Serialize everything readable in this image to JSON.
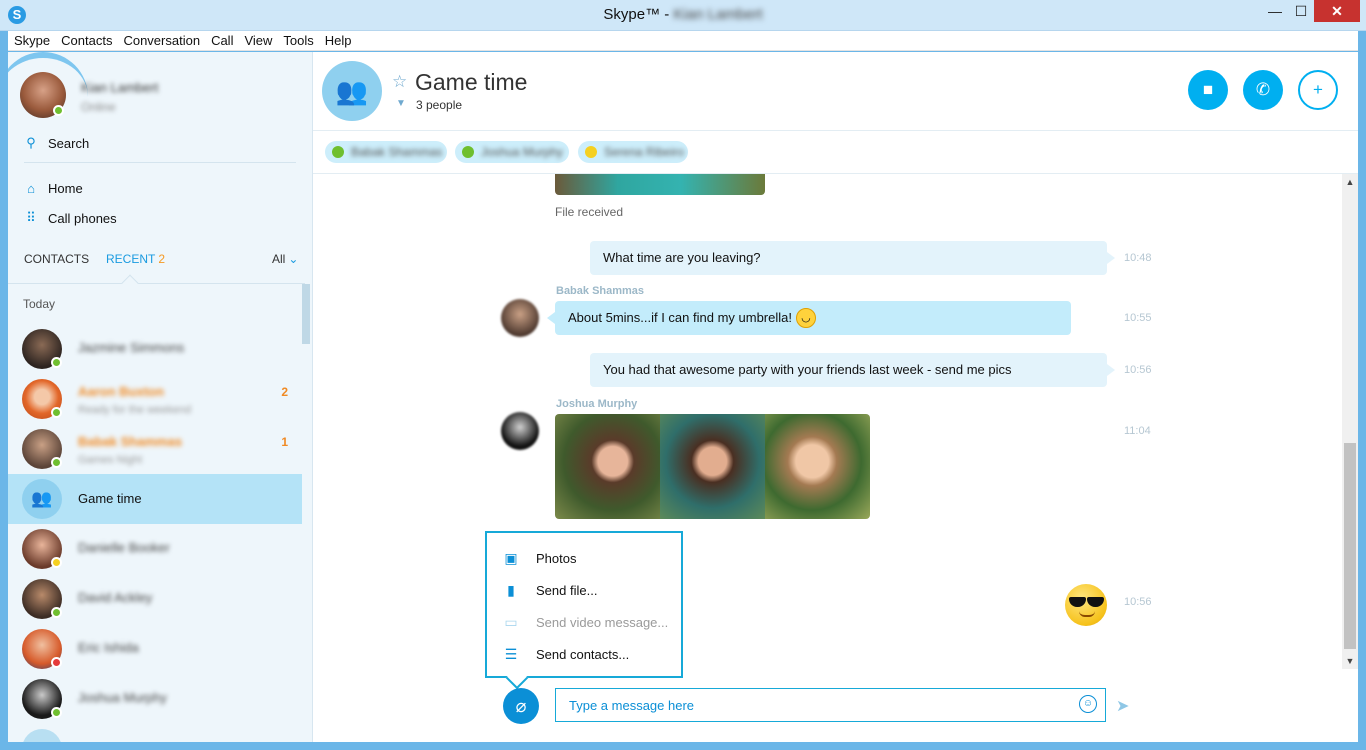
{
  "window": {
    "title": "Skype™ - ",
    "title_user": "Kian Lambert",
    "app_logo": "S",
    "controls": {
      "minimize": "—",
      "maximize": "☐",
      "close": "✕"
    }
  },
  "menu": [
    "Skype",
    "Contacts",
    "Conversation",
    "Call",
    "View",
    "Tools",
    "Help"
  ],
  "sidebar": {
    "me": {
      "name": "Kian Lambert",
      "status": "Online"
    },
    "search_label": "Search",
    "nav": {
      "home": "Home",
      "call_phones": "Call phones"
    },
    "tabs": {
      "contacts": "CONTACTS",
      "recent": "RECENT",
      "recent_count": "2",
      "filter": "All"
    },
    "section": "Today",
    "contacts": [
      {
        "name": "Jazmine Simmons",
        "mood": "",
        "count": ""
      },
      {
        "name": "Aaron Buxton",
        "mood": "Ready for the weekend",
        "count": "2"
      },
      {
        "name": "Babak Shammas",
        "mood": "Games Night",
        "count": "1"
      },
      {
        "name": "Game time",
        "mood": "",
        "count": ""
      },
      {
        "name": "Danielle Booker",
        "mood": "",
        "count": ""
      },
      {
        "name": "David Ackley",
        "mood": "",
        "count": ""
      },
      {
        "name": "Eric Ishida",
        "mood": "",
        "count": ""
      },
      {
        "name": "Joshua Murphy",
        "mood": "",
        "count": ""
      }
    ]
  },
  "conversation": {
    "title": "Game time",
    "people": "3 people",
    "participants": [
      "Babak Shammas",
      "Joshua Murphy",
      "Serena Ribeiro"
    ],
    "file_received": "File received",
    "messages": [
      {
        "text": "What time are you leaving?",
        "time": "10:48"
      },
      {
        "sender": "Babak Shammas",
        "text": "About 5mins...if I can find my umbrella!",
        "time": "10:55"
      },
      {
        "text": "You had that awesome party with your friends last week - send me pics",
        "time": "10:56"
      },
      {
        "sender": "Joshua Murphy",
        "time": "11:04"
      },
      {
        "time": "10:56"
      }
    ]
  },
  "attach_menu": {
    "photos": "Photos",
    "send_file": "Send file...",
    "send_video": "Send video message...",
    "send_contacts": "Send contacts..."
  },
  "compose": {
    "placeholder": "Type a message here"
  },
  "colors": {
    "accent": "#00aff0",
    "unread": "#f08a24",
    "online": "#6fbf2f"
  }
}
